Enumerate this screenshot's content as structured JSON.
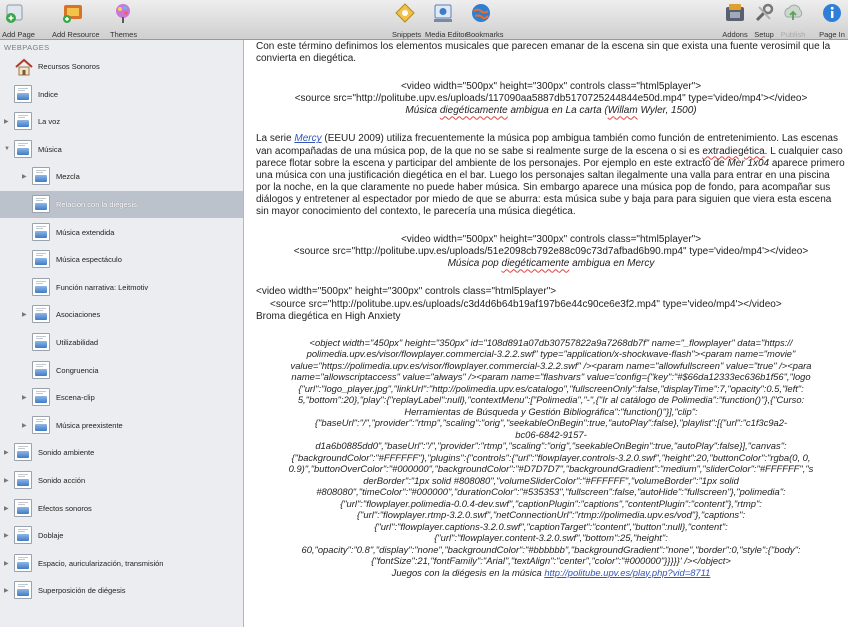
{
  "toolbar": {
    "left": [
      {
        "label": "Add Page",
        "icon": "add-page-icon"
      },
      {
        "label": "Add Resource",
        "icon": "add-resource-icon"
      },
      {
        "label": "Themes",
        "icon": "themes-icon"
      }
    ],
    "center": [
      {
        "label": "Snippets",
        "icon": "snippets-icon"
      },
      {
        "label": "Media Editor",
        "icon": "media-editor-icon"
      },
      {
        "label": "Bookmarks",
        "icon": "bookmarks-icon"
      }
    ],
    "right": [
      {
        "label": "Addons",
        "icon": "addons-icon"
      },
      {
        "label": "Setup",
        "icon": "setup-icon"
      },
      {
        "label": "Publish",
        "icon": "publish-icon",
        "disabled": true
      },
      {
        "label": "Page In",
        "icon": "page-info-icon"
      }
    ]
  },
  "sidebar": {
    "header": "WEBPAGES",
    "items": [
      {
        "label": "Recursos Sonoros",
        "level": 0,
        "icon": "home-icon"
      },
      {
        "label": "Indice",
        "level": 0,
        "icon": "page-icon"
      },
      {
        "label": "La voz",
        "level": 0,
        "icon": "page-icon",
        "toggle": "collapsed"
      },
      {
        "label": "Música",
        "level": 0,
        "icon": "page-icon",
        "toggle": "expanded"
      },
      {
        "label": "Mezcla",
        "level": 1,
        "icon": "page-icon",
        "toggle": "collapsed"
      },
      {
        "label": "Relación con la diégesis",
        "level": 1,
        "icon": "page-icon",
        "selected": true
      },
      {
        "label": "Música extendida",
        "level": 1,
        "icon": "page-icon"
      },
      {
        "label": "Música espectáculo",
        "level": 1,
        "icon": "page-icon"
      },
      {
        "label": "Función narrativa: Leitmotiv",
        "level": 1,
        "icon": "page-icon"
      },
      {
        "label": "Asociaciones",
        "level": 1,
        "icon": "page-icon",
        "toggle": "collapsed"
      },
      {
        "label": "Utilizabilidad",
        "level": 1,
        "icon": "page-icon"
      },
      {
        "label": "Congruencia",
        "level": 1,
        "icon": "page-icon"
      },
      {
        "label": "Escena-clip",
        "level": 1,
        "icon": "page-icon",
        "toggle": "collapsed"
      },
      {
        "label": "Música preexistente",
        "level": 1,
        "icon": "page-icon",
        "toggle": "collapsed"
      },
      {
        "label": "Sonido ambiente",
        "level": 0,
        "icon": "page-icon",
        "toggle": "collapsed"
      },
      {
        "label": "Sonido acción",
        "level": 0,
        "icon": "page-icon",
        "toggle": "collapsed"
      },
      {
        "label": "Efectos sonoros",
        "level": 0,
        "icon": "page-icon",
        "toggle": "collapsed"
      },
      {
        "label": "Doblaje",
        "level": 0,
        "icon": "page-icon",
        "toggle": "collapsed"
      },
      {
        "label": "Espacio, auricularización, transmisión",
        "level": 0,
        "icon": "page-icon",
        "toggle": "collapsed"
      },
      {
        "label": "Superposición de diégesis",
        "level": 0,
        "icon": "page-icon",
        "toggle": "collapsed"
      }
    ]
  },
  "content": {
    "p1": "Con este término  definimos los elementos musicales que parecen emanar de la escena sin que exista una fuente verosimil que la convierta en diegética.",
    "v1_line1": "<video width=\"500px\" height=\"300px\" controls class=\"html5player\">",
    "v1_line2": "<source src=\"http://politube.upv.es/uploads/117090aa5887db5170725244844e50d.mp4\" type='video/mp4'></video>",
    "v1_cap_a": "Música ",
    "v1_cap_b": "diegéticamente",
    "v1_cap_c": " ambigua en La carta (",
    "v1_cap_d": "Willam",
    "v1_cap_e": " Wyler, 1500)",
    "p2_a": "La serie ",
    "p2_link": "Mercy",
    "p2_b": " (EEUU 2009) utiliza frecuentemente la música pop ambigua también como función de entretenimiento. Las escenas van acompañadas de una música pop, de la que no se sabe si realmente surge de la escena o si es ",
    "p2_sq": "extradiegética",
    "p2_c": ". L cualquier caso parece flotar sobre la escena y participar del ambiente de los personajes. Por ejemplo en este extracto de ",
    "p2_mer": "Mer 1x04",
    "p2_d": " aparece primero una música con una justificación diegética en el bar. Luego los personajes saltan ilegalmente una valla para entrar en una piscina por la noche, en la que claramente no puede haber música. Sin embargo aparece una música pop de fondo, para acompañar sus diálogos y entretener al espectador por miedo de que se aburra: esta música sube y baja para para siguien que viera esta escena sin mayor conocimiento del contexto, le parecería una música diegética.",
    "v2_line1": "<video width=\"500px\" height=\"300px\" controls class=\"html5player\">",
    "v2_line2": "<source src=\"http://politube.upv.es/uploads/51e2098cb792e88c09c73d7afbad6b90.mp4\" type='video/mp4'></video>",
    "v2_cap_a": "Música pop ",
    "v2_cap_b": "diegéticamente",
    "v2_cap_c": " ambigua en Mercy",
    "v3_line1": "<video width=\"500px\" height=\"300px\" controls class=\"html5player\">",
    "v3_line2": "<source src=\"http://politube.upv.es/uploads/c3d4d6b64b19af197b6e44c90ce6e3f2.mp4\" type='video/mp4'></video>",
    "v3_line3": "Broma diegética en High Anxiety",
    "obj_lines": [
      "<object width=\"450px\" height=\"350px\" id=\"108d891a07db30757822a9a7268db7f\" name=\"_flowplayer\" data=\"https://",
      "polimedia.upv.es/visor/flowplayer.commercial-3.2.2.swf\" type=\"application/x-shockwave-flash\"><param name=\"movie\"",
      "value=\"https://polimedia.upv.es/visor/flowplayer.commercial-3.2.2.swf\" /><param name=\"allowfullscreen\" value=\"true\" /><para",
      "name=\"allowscriptaccess\" value=\"always\" /><param name=\"flashvars\" value='config={\"key\":\"#$66da12333ec636b1f56\",\"logo",
      "{\"url\":\"logo_player.jpg\",\"linkUrl\":\"http://polimedia.upv.es/catalogo\",\"fullscreenOnly\":false,\"displayTime\":7,\"opacity\":0.5,\"left\":",
      "5,\"bottom\":20},\"play\":{\"replayLabel\":null},\"contextMenu\":[\"Polimedia\",\"-\",{\"Ir al catálogo de Polimedia\":\"function()\"},{\"Curso:",
      "Herramientas de Búsqueda y Gestión Bibliográfica\":\"function()\"}],\"clip\":",
      "{\"baseUrl\":\"/\",\"provider\":\"rtmp\",\"scaling\":\"orig\",\"seekableOnBegin\":true,\"autoPlay\":false},\"playlist\":[{\"url\":\"c1f3c9a2-",
      "d1a6b0885dd0\",\"baseUrl\":\"/\",\"provider\":\"rtmp\",\"scaling\":\"orig\",\"seekableOnBegin\":true,\"autoPlay\":false}],\"canvas\":",
      "{\"backgroundColor\":\"#FFFFFF\"},\"plugins\":{\"controls\":{\"url\":\"flowplayer.controls-3.2.0.swf\",\"height\":20,\"buttonColor\":\"rgba(0, 0,",
      "0.9)\",\"buttonOverColor\":\"#000000\",\"backgroundColor\":\"#D7D7D7\",\"backgroundGradient\":\"medium\",\"sliderColor\":\"#FFFFFF\",\"s",
      "derBorder\":\"1px solid #808080\",\"volumeSliderColor\":\"#FFFFFF\",\"volumeBorder\":\"1px solid",
      "#808080\",\"timeColor\":\"#000000\",\"durationColor\":\"#535353\",\"fullscreen\":false,\"autoHide\":\"fullscreen\"},\"polimedia\":",
      "{\"url\":\"flowplayer.polimedia-0.0.4-dev.swf\",\"captionPlugin\":\"captions\",\"contentPlugin\":\"content\"},\"rtmp\":",
      "{\"url\":\"flowplayer.rtmp-3.2.0.swf\",\"netConnectionUrl\":\"rtmp://polimedia.upv.es/vod\"},\"captions\":",
      "{\"url\":\"flowplayer.captions-3.2.0.swf\",\"captionTarget\":\"content\",\"button\":null},\"content\":",
      "{\"url\":\"flowplayer.content-3.2.0.swf\",\"bottom\":25,\"height\":",
      "60,\"opacity\":\"0.8\",\"display\":\"none\",\"backgroundColor\":\"#bbbbbb\",\"backgroundGradient\":\"none\",\"border\":0,\"style\":{\"body\":",
      "{\"fontSize\":21,\"fontFamily\":\"Arial\",\"textAlign\":\"center\",\"color\":\"#000000\"}}}}}' /></object>"
    ],
    "obj_extra": "bc06-6842-9157-",
    "obj_cap_a": "Juegos con la diégesis en la música ",
    "obj_cap_link": "http://politube.upv.es/play.php?vid=8711"
  },
  "colors": {
    "link": "#3355bb",
    "selected_row": "#bcc2cb",
    "sidebar_bg": "#ecedf0"
  }
}
